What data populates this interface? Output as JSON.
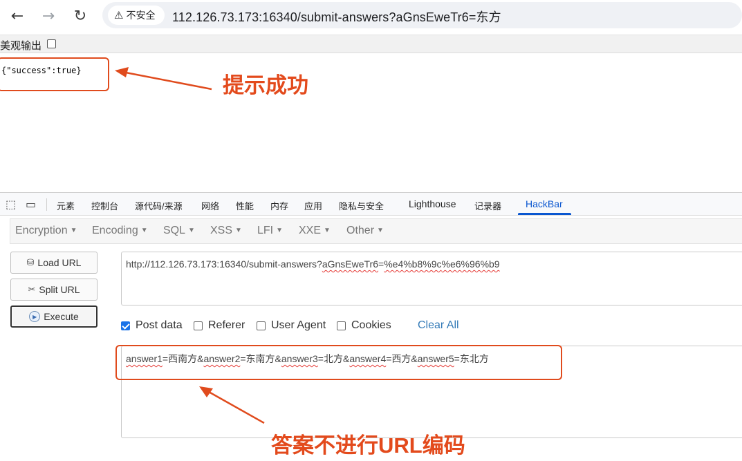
{
  "browser": {
    "back_icon": "arrow-left-icon",
    "forward_icon": "arrow-right-icon",
    "reload_icon": "reload-icon",
    "security_label": "不安全",
    "url": "112.126.73.173:16340/submit-answers?aGnsEweTr6=东方"
  },
  "page": {
    "pretty_print_label": "美观输出",
    "json_output": "{\"success\":true}"
  },
  "annotations": {
    "top_note": "提示成功",
    "bottom_note": "答案不进行URL编码",
    "color": "#e34a1c"
  },
  "devtools": {
    "tabs": [
      "元素",
      "控制台",
      "源代码/来源",
      "网络",
      "性能",
      "内存",
      "应用",
      "隐私与安全",
      "Lighthouse",
      "记录器",
      "HackBar"
    ],
    "active_tab": "HackBar"
  },
  "hackbar": {
    "menus": [
      "Encryption",
      "Encoding",
      "SQL",
      "XSS",
      "LFI",
      "XXE",
      "Other"
    ],
    "buttons": {
      "load_url": "Load URL",
      "split_url": "Split URL",
      "execute": "Execute"
    },
    "url_prefix": "http://112.126.73.173:16340/submit-answers?",
    "url_key": "aGnsEweTr6",
    "url_eq": "=",
    "url_v1": "%e4",
    "url_v2": "%b8",
    "url_v3": "%9c",
    "url_v4": "%e6",
    "url_v5": "%96",
    "url_v6": "%b9",
    "options": {
      "post_data": "Post data",
      "referer": "Referer",
      "user_agent": "User Agent",
      "cookies": "Cookies",
      "clear_all": "Clear All"
    },
    "post_data_checked": true,
    "post": {
      "k1": "answer1",
      "v1": "=西南方&",
      "k2": "answer2",
      "v2": "=东南方&",
      "k3": "answer3",
      "v3": "=北方&",
      "k4": "answer4",
      "v4": "=西方&",
      "k5": "answer5",
      "v5": "=东北方"
    }
  }
}
